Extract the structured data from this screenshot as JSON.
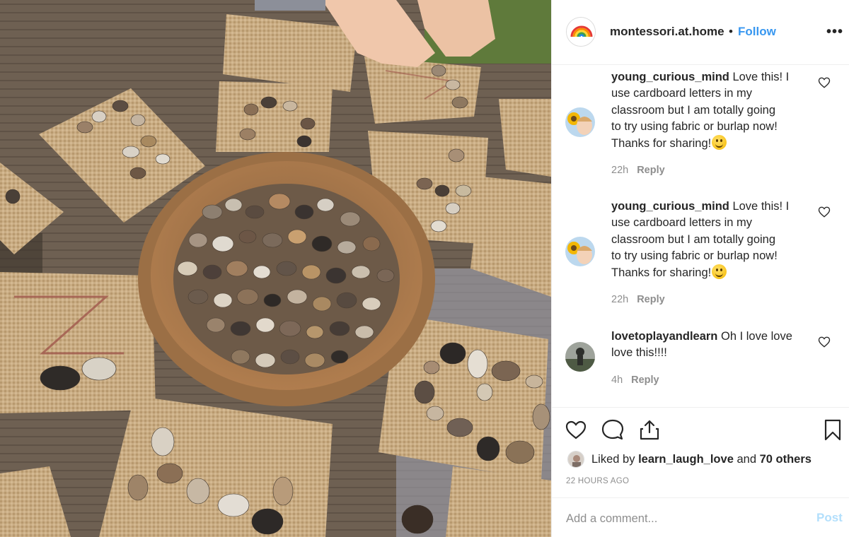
{
  "post": {
    "photo_label": "photo-burlap-letter-stones"
  },
  "header": {
    "username": "montessori.at.home",
    "separator": "•",
    "follow_label": "Follow",
    "more_label": "•••"
  },
  "comments": [
    {
      "user": "young_curious_mind",
      "text_line1": "Love this! I",
      "text_rest": [
        "use cardboard letters in my",
        "classroom but I am totally going",
        "to try using fabric or burlap now!",
        "Thanks for sharing!"
      ],
      "time": "22h",
      "reply_label": "Reply"
    },
    {
      "user": "young_curious_mind",
      "text_line1": "Love this! I",
      "text_rest": [
        "use cardboard letters in my",
        "classroom but I am totally going",
        "to try using fabric or burlap now!",
        "Thanks for sharing!"
      ],
      "time": "22h",
      "reply_label": "Reply"
    },
    {
      "user": "lovetoplayandlearn",
      "text_line1": "Oh I love love",
      "text_rest": [
        "love this!!!!"
      ],
      "time": "4h",
      "reply_label": "Reply"
    }
  ],
  "actions": {
    "icons": [
      "heart-icon",
      "comment-icon",
      "share-icon",
      "bookmark-icon"
    ]
  },
  "likes": {
    "prefix": "Liked by",
    "user": "learn_laugh_love",
    "and": "and",
    "others": "70 others"
  },
  "time_ago": "22 HOURS AGO",
  "add_comment": {
    "placeholder": "Add a comment...",
    "post_label": "Post"
  },
  "colors": {
    "accent": "#3897f0",
    "post_disabled": "#b2dffc",
    "muted": "#8e8e8e",
    "text": "#262626"
  }
}
